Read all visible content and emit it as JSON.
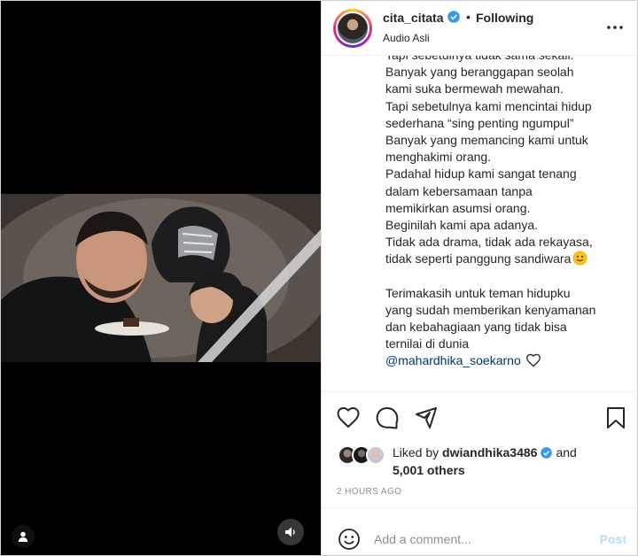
{
  "post": {
    "username": "cita_citata",
    "verified": true,
    "separator": "•",
    "follow_status": "Following",
    "audio": "Audio Asli",
    "more_icon": "more-horizontal-icon"
  },
  "caption": {
    "lines": [
      "Tapi sebetulnya tidak sama sekali.",
      "Banyak yang beranggapan seolah",
      "kami suka bermewah mewahan.",
      "Tapi sebetulnya kami mencintai hidup",
      "sederhana “sing penting ngumpul”",
      "Banyak yang memancing kami untuk",
      "menghakimi orang.",
      "Padahal hidup kami sangat tenang",
      "dalam kebersamaan tanpa",
      "memikirkan asumsi orang.",
      "Beginilah kami apa adanya.",
      "Tidak ada drama, tidak ada rekayasa,",
      "tidak seperti panggung sandiwara",
      "",
      "Terimakasih untuk teman hidupku",
      "yang sudah memberikan kenyamanan",
      "dan kebahagiaan yang tidak bisa",
      "ternilai di dunia"
    ],
    "mention": "@mahardhika_soekarno"
  },
  "actions": {
    "like_icon": "heart-icon",
    "comment_icon": "comment-icon",
    "share_icon": "share-icon",
    "save_icon": "bookmark-icon"
  },
  "likes": {
    "prefix": "Liked by",
    "user": "dwiandhika3486",
    "conjunction": "and",
    "others": "5,001 others"
  },
  "timestamp": "2 HOURS AGO",
  "comment": {
    "placeholder": "Add a comment...",
    "post_label": "Post"
  },
  "colors": {
    "verified": "#3897f0",
    "mention": "#00376b",
    "post_disabled": "#b2dffc",
    "muted": "#8e8e8e"
  }
}
